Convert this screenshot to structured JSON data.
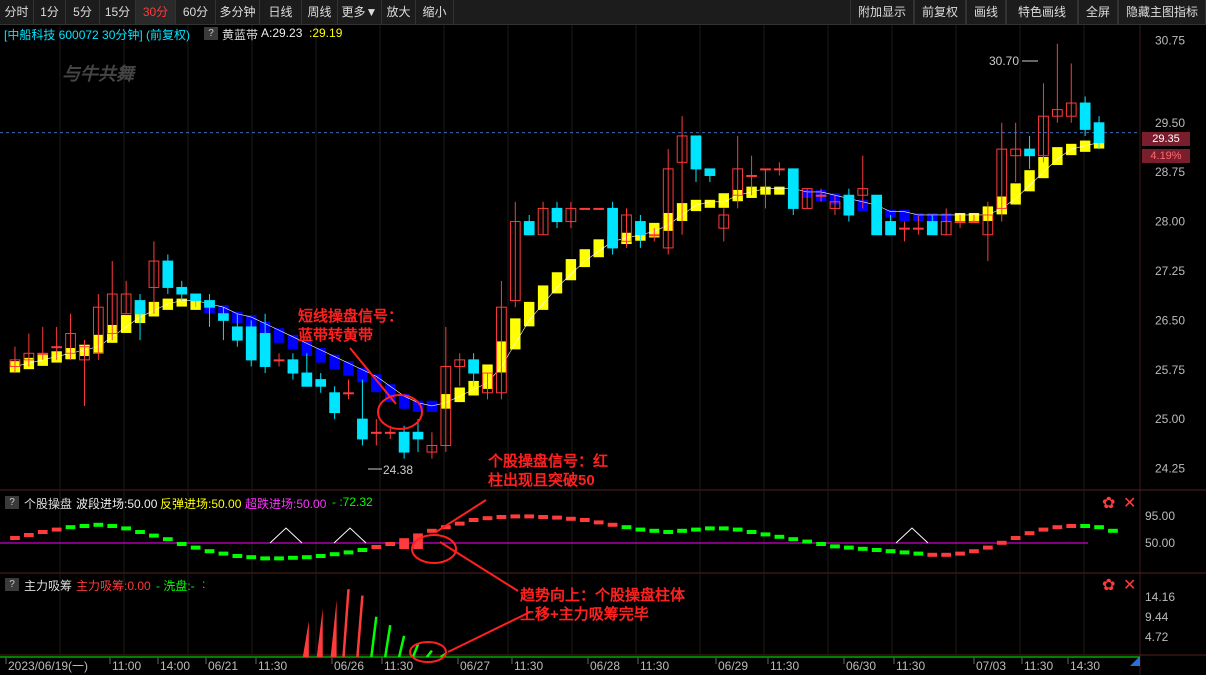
{
  "toolbar": {
    "left": [
      "分时",
      "1分",
      "5分",
      "15分",
      "30分",
      "60分",
      "多分钟",
      "日线",
      "周线",
      "更多▼",
      "放大",
      "缩小"
    ],
    "right": [
      "附加显示",
      "前复权",
      "画线",
      "特色画线",
      "全屏",
      "隐藏主图指标"
    ],
    "active": "30分"
  },
  "main_panel": {
    "stock_label": "[中船科技 600072 30分钟] (前复权)",
    "question": "?",
    "indicator_name": "黄蓝带",
    "indicator_value_a": "A:29.23",
    "indicator_value_b": ":29.19",
    "watermark": "与牛共舞",
    "price_tag": "29.35",
    "pct_tag": "4.19%",
    "high_label": "30.70",
    "low_label": "24.38"
  },
  "sub1": {
    "name": "个股操盘",
    "v1": "波段进场:50.00",
    "v2": "反弹进场:50.00",
    "v3": "超跌进场:50.00",
    "v4": "- :72.32",
    "axis": [
      "95.00",
      "50.00"
    ]
  },
  "sub2": {
    "name": "主力吸筹",
    "v1": "主力吸筹:0.00",
    "v2": "- 洗盘:-",
    "v3": ":",
    "axis": [
      "14.16",
      "9.44",
      "4.72"
    ]
  },
  "annotations": {
    "a1": [
      "短线操盘信号：",
      "蓝带转黄带"
    ],
    "a2": [
      "个股操盘信号：红",
      "柱出现且突破50"
    ],
    "a3": [
      "趋势向上：个股操盘柱体",
      "上移+主力吸筹完毕"
    ]
  },
  "time_axis": [
    "2023/06/19(一)",
    "11:00",
    "14:00",
    "06/21",
    "11:30",
    "06/26",
    "11:30",
    "06/27",
    "11:30",
    "06/28",
    "11:30",
    "06/29",
    "11:30",
    "06/30",
    "11:30",
    "07/03",
    "11:30",
    "14:30"
  ],
  "colors": {
    "up": "#ff3b3b",
    "down": "#00e5ff",
    "yellow": "#ffff00",
    "blue": "#0000ff",
    "magenta": "#ff00ff",
    "green": "#00ff00"
  },
  "chart_data": {
    "type": "candlestick",
    "price_axis": [
      "30.75",
      "29.50",
      "28.75",
      "28.00",
      "27.25",
      "26.50",
      "25.75",
      "25.00",
      "24.25"
    ],
    "ylim": [
      24.0,
      31.0
    ],
    "candles": [
      [
        25.8,
        25.9,
        26.1,
        25.7
      ],
      [
        25.9,
        26.0,
        26.3,
        25.8
      ],
      [
        26.0,
        26.0,
        26.4,
        25.9
      ],
      [
        26.1,
        26.1,
        26.4,
        25.9
      ],
      [
        26.0,
        26.3,
        26.6,
        25.9
      ],
      [
        25.9,
        26.1,
        26.2,
        25.2
      ],
      [
        26.0,
        26.7,
        26.9,
        25.9
      ],
      [
        26.3,
        26.9,
        27.4,
        26.2
      ],
      [
        26.6,
        26.9,
        27.1,
        26.6
      ],
      [
        26.8,
        26.6,
        26.9,
        26.2
      ],
      [
        27.0,
        27.4,
        27.7,
        26.6
      ],
      [
        27.4,
        27.0,
        27.5,
        26.9
      ],
      [
        27.0,
        26.9,
        27.1,
        26.8
      ],
      [
        26.9,
        26.8,
        26.9,
        26.7
      ],
      [
        26.8,
        26.7,
        26.9,
        26.4
      ],
      [
        26.6,
        26.5,
        26.7,
        26.2
      ],
      [
        26.4,
        26.2,
        26.6,
        26.1
      ],
      [
        26.4,
        25.9,
        26.5,
        25.8
      ],
      [
        26.3,
        25.8,
        26.6,
        25.7
      ],
      [
        25.9,
        25.9,
        26.0,
        25.8
      ],
      [
        25.9,
        25.7,
        26.0,
        25.6
      ],
      [
        25.7,
        25.5,
        26.0,
        25.5
      ],
      [
        25.6,
        25.5,
        25.7,
        25.4
      ],
      [
        25.4,
        25.1,
        25.5,
        25.0
      ],
      [
        25.4,
        25.4,
        25.6,
        25.3
      ],
      [
        25.0,
        24.7,
        25.6,
        24.6
      ],
      [
        24.8,
        24.8,
        25.0,
        24.6
      ],
      [
        24.8,
        24.8,
        24.9,
        24.7
      ],
      [
        24.8,
        24.5,
        24.9,
        24.4
      ],
      [
        24.8,
        24.7,
        25.0,
        24.5
      ],
      [
        24.5,
        24.6,
        24.8,
        24.4
      ],
      [
        24.6,
        25.8,
        26.4,
        24.5
      ],
      [
        25.8,
        25.9,
        26.0,
        25.5
      ],
      [
        25.9,
        25.7,
        26.0,
        25.5
      ],
      [
        25.4,
        25.7,
        25.7,
        25.3
      ],
      [
        25.4,
        26.7,
        27.1,
        25.3
      ],
      [
        26.8,
        28.0,
        28.3,
        26.7
      ],
      [
        28.0,
        27.8,
        28.1,
        27.8
      ],
      [
        27.8,
        28.2,
        28.3,
        27.8
      ],
      [
        28.2,
        28.0,
        28.3,
        27.9
      ],
      [
        28.0,
        28.2,
        28.3,
        27.9
      ],
      [
        28.2,
        28.2,
        28.2,
        28.2
      ],
      [
        28.2,
        28.2,
        28.2,
        28.2
      ],
      [
        28.2,
        27.6,
        28.3,
        27.5
      ],
      [
        27.7,
        28.1,
        28.2,
        27.6
      ],
      [
        28.0,
        27.8,
        28.1,
        27.6
      ],
      [
        27.8,
        27.8,
        27.9,
        27.7
      ],
      [
        27.6,
        28.8,
        29.1,
        27.5
      ],
      [
        28.9,
        29.3,
        29.6,
        27.8
      ],
      [
        29.3,
        28.8,
        29.3,
        28.6
      ],
      [
        28.8,
        28.7,
        28.8,
        28.6
      ],
      [
        27.9,
        28.1,
        28.2,
        27.7
      ],
      [
        28.4,
        28.8,
        29.3,
        28.2
      ],
      [
        28.7,
        28.7,
        29.0,
        28.4
      ],
      [
        28.8,
        28.8,
        28.8,
        28.2
      ],
      [
        28.8,
        28.8,
        28.9,
        28.7
      ],
      [
        28.8,
        28.2,
        28.8,
        28.1
      ],
      [
        28.2,
        28.5,
        28.5,
        28.2
      ],
      [
        28.4,
        28.4,
        28.5,
        28.3
      ],
      [
        28.2,
        28.3,
        28.4,
        28.1
      ],
      [
        28.4,
        28.1,
        28.5,
        28.0
      ],
      [
        28.4,
        28.5,
        29.0,
        28.2
      ],
      [
        28.4,
        27.8,
        28.4,
        27.8
      ],
      [
        28.0,
        27.8,
        28.1,
        27.8
      ],
      [
        27.9,
        27.9,
        28.0,
        27.7
      ],
      [
        27.9,
        27.9,
        28.1,
        27.8
      ],
      [
        28.0,
        27.8,
        28.1,
        27.8
      ],
      [
        27.8,
        28.0,
        28.2,
        27.8
      ],
      [
        28.0,
        28.0,
        28.1,
        27.9
      ],
      [
        28.0,
        28.0,
        28.1,
        28.0
      ],
      [
        27.8,
        28.1,
        28.3,
        27.4
      ],
      [
        28.2,
        29.1,
        29.5,
        28.0
      ],
      [
        29.0,
        29.1,
        29.5,
        28.6
      ],
      [
        29.1,
        29.0,
        29.3,
        28.8
      ],
      [
        29.0,
        29.6,
        30.1,
        28.9
      ],
      [
        29.6,
        29.7,
        30.7,
        29.5
      ],
      [
        29.6,
        29.8,
        30.4,
        29.5
      ],
      [
        29.8,
        29.4,
        29.9,
        29.3
      ],
      [
        29.5,
        29.2,
        29.6,
        29.1
      ]
    ],
    "band": [
      [
        25.8,
        "y"
      ],
      [
        25.85,
        "y"
      ],
      [
        25.9,
        "y"
      ],
      [
        25.95,
        "y"
      ],
      [
        26.0,
        "y"
      ],
      [
        26.05,
        "y"
      ],
      [
        26.1,
        "y"
      ],
      [
        26.25,
        "y"
      ],
      [
        26.4,
        "y"
      ],
      [
        26.55,
        "y"
      ],
      [
        26.65,
        "y"
      ],
      [
        26.75,
        "y"
      ],
      [
        26.8,
        "y"
      ],
      [
        26.8,
        "y"
      ],
      [
        26.75,
        "b"
      ],
      [
        26.7,
        "b"
      ],
      [
        26.6,
        "b"
      ],
      [
        26.55,
        "b"
      ],
      [
        26.45,
        "b"
      ],
      [
        26.35,
        "b"
      ],
      [
        26.25,
        "b"
      ],
      [
        26.15,
        "b"
      ],
      [
        26.05,
        "b"
      ],
      [
        25.95,
        "b"
      ],
      [
        25.85,
        "b"
      ],
      [
        25.75,
        "b"
      ],
      [
        25.65,
        "b"
      ],
      [
        25.5,
        "b"
      ],
      [
        25.35,
        "b"
      ],
      [
        25.25,
        "b"
      ],
      [
        25.2,
        "b"
      ],
      [
        25.25,
        "y"
      ],
      [
        25.35,
        "y"
      ],
      [
        25.45,
        "y"
      ],
      [
        25.55,
        "y"
      ],
      [
        25.8,
        "y"
      ],
      [
        26.15,
        "y"
      ],
      [
        26.5,
        "y"
      ],
      [
        26.75,
        "y"
      ],
      [
        27.0,
        "y"
      ],
      [
        27.2,
        "y"
      ],
      [
        27.4,
        "y"
      ],
      [
        27.55,
        "y"
      ],
      [
        27.7,
        "y"
      ],
      [
        27.75,
        "y"
      ],
      [
        27.8,
        "y"
      ],
      [
        27.85,
        "y"
      ],
      [
        27.95,
        "y"
      ],
      [
        28.1,
        "y"
      ],
      [
        28.25,
        "y"
      ],
      [
        28.3,
        "y"
      ],
      [
        28.3,
        "y"
      ],
      [
        28.4,
        "y"
      ],
      [
        28.45,
        "y"
      ],
      [
        28.5,
        "y"
      ],
      [
        28.5,
        "y"
      ],
      [
        28.5,
        "b"
      ],
      [
        28.45,
        "b"
      ],
      [
        28.45,
        "b"
      ],
      [
        28.4,
        "b"
      ],
      [
        28.35,
        "b"
      ],
      [
        28.3,
        "b"
      ],
      [
        28.25,
        "b"
      ],
      [
        28.15,
        "b"
      ],
      [
        28.15,
        "b"
      ],
      [
        28.1,
        "b"
      ],
      [
        28.1,
        "b"
      ],
      [
        28.1,
        "b"
      ],
      [
        28.1,
        "y"
      ],
      [
        28.1,
        "y"
      ],
      [
        28.1,
        "y"
      ],
      [
        28.2,
        "y"
      ],
      [
        28.35,
        "y"
      ],
      [
        28.55,
        "y"
      ],
      [
        28.75,
        "y"
      ],
      [
        28.95,
        "y"
      ],
      [
        29.1,
        "y"
      ],
      [
        29.15,
        "y"
      ],
      [
        29.2,
        "y"
      ]
    ]
  }
}
